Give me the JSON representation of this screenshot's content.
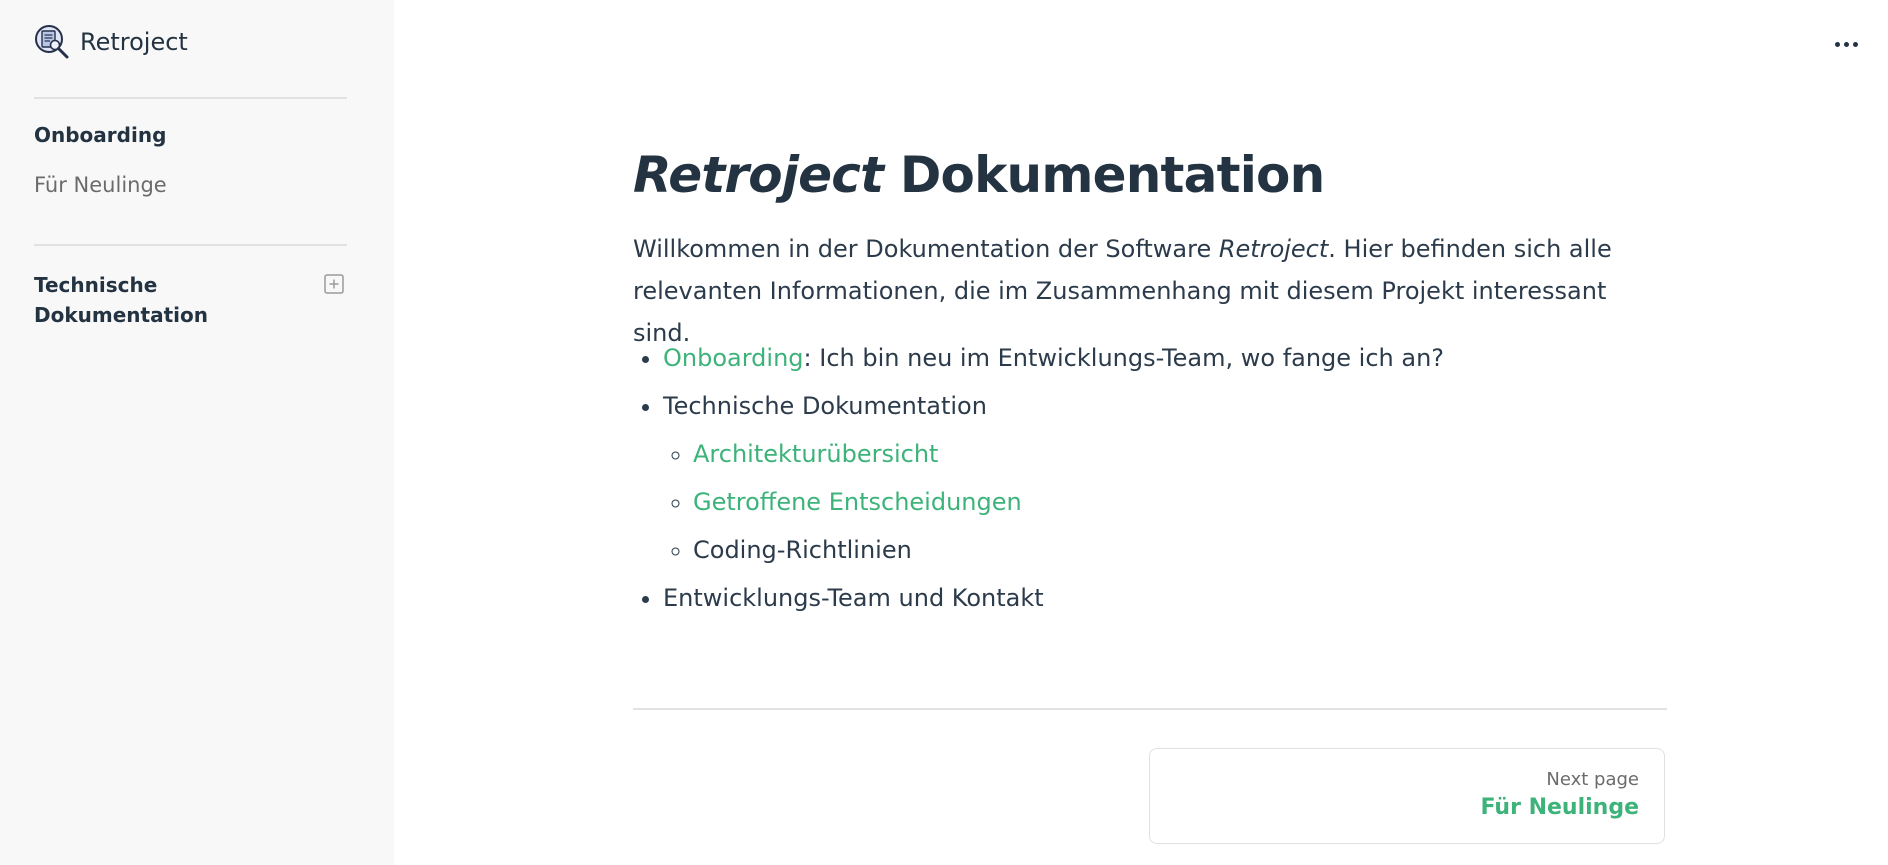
{
  "brand": {
    "name": "Retroject",
    "icon": "magnifier-document-icon"
  },
  "sidebar": {
    "sections": [
      {
        "title": "Onboarding",
        "items": [
          {
            "label": "Für Neulinge"
          }
        ]
      },
      {
        "title": "Technische Dokumentation",
        "expand_icon": "plus-square-icon"
      }
    ]
  },
  "header": {
    "more_icon": "ellipsis-icon"
  },
  "main": {
    "title_italic": "Retroject",
    "title_rest": " Dokumentation",
    "intro": {
      "part1": "Willkommen in der Dokumentation der Software ",
      "italic": "Retroject",
      "part2": ". Hier befinden sich alle relevanten Informationen, die im Zusammenhang mit diesem Projekt interessant sind."
    },
    "list": {
      "onboarding_link": "Onboarding",
      "onboarding_text": ": Ich bin neu im Entwicklungs-Team, wo fange ich an?",
      "tech_docs": "Technische Dokumentation",
      "sub": {
        "architecture": "Architekturübersicht",
        "decisions": "Getroffene Entscheidungen",
        "coding": "Coding-Richtlinien"
      },
      "team": "Entwicklungs-Team und Kontakt"
    }
  },
  "pagination": {
    "kicker": "Next page",
    "title": "Für Neulinge"
  },
  "colors": {
    "accent": "#3db37a",
    "text": "#243342",
    "sidebar_bg": "#f8f8f8",
    "muted": "#6b6b6b"
  }
}
